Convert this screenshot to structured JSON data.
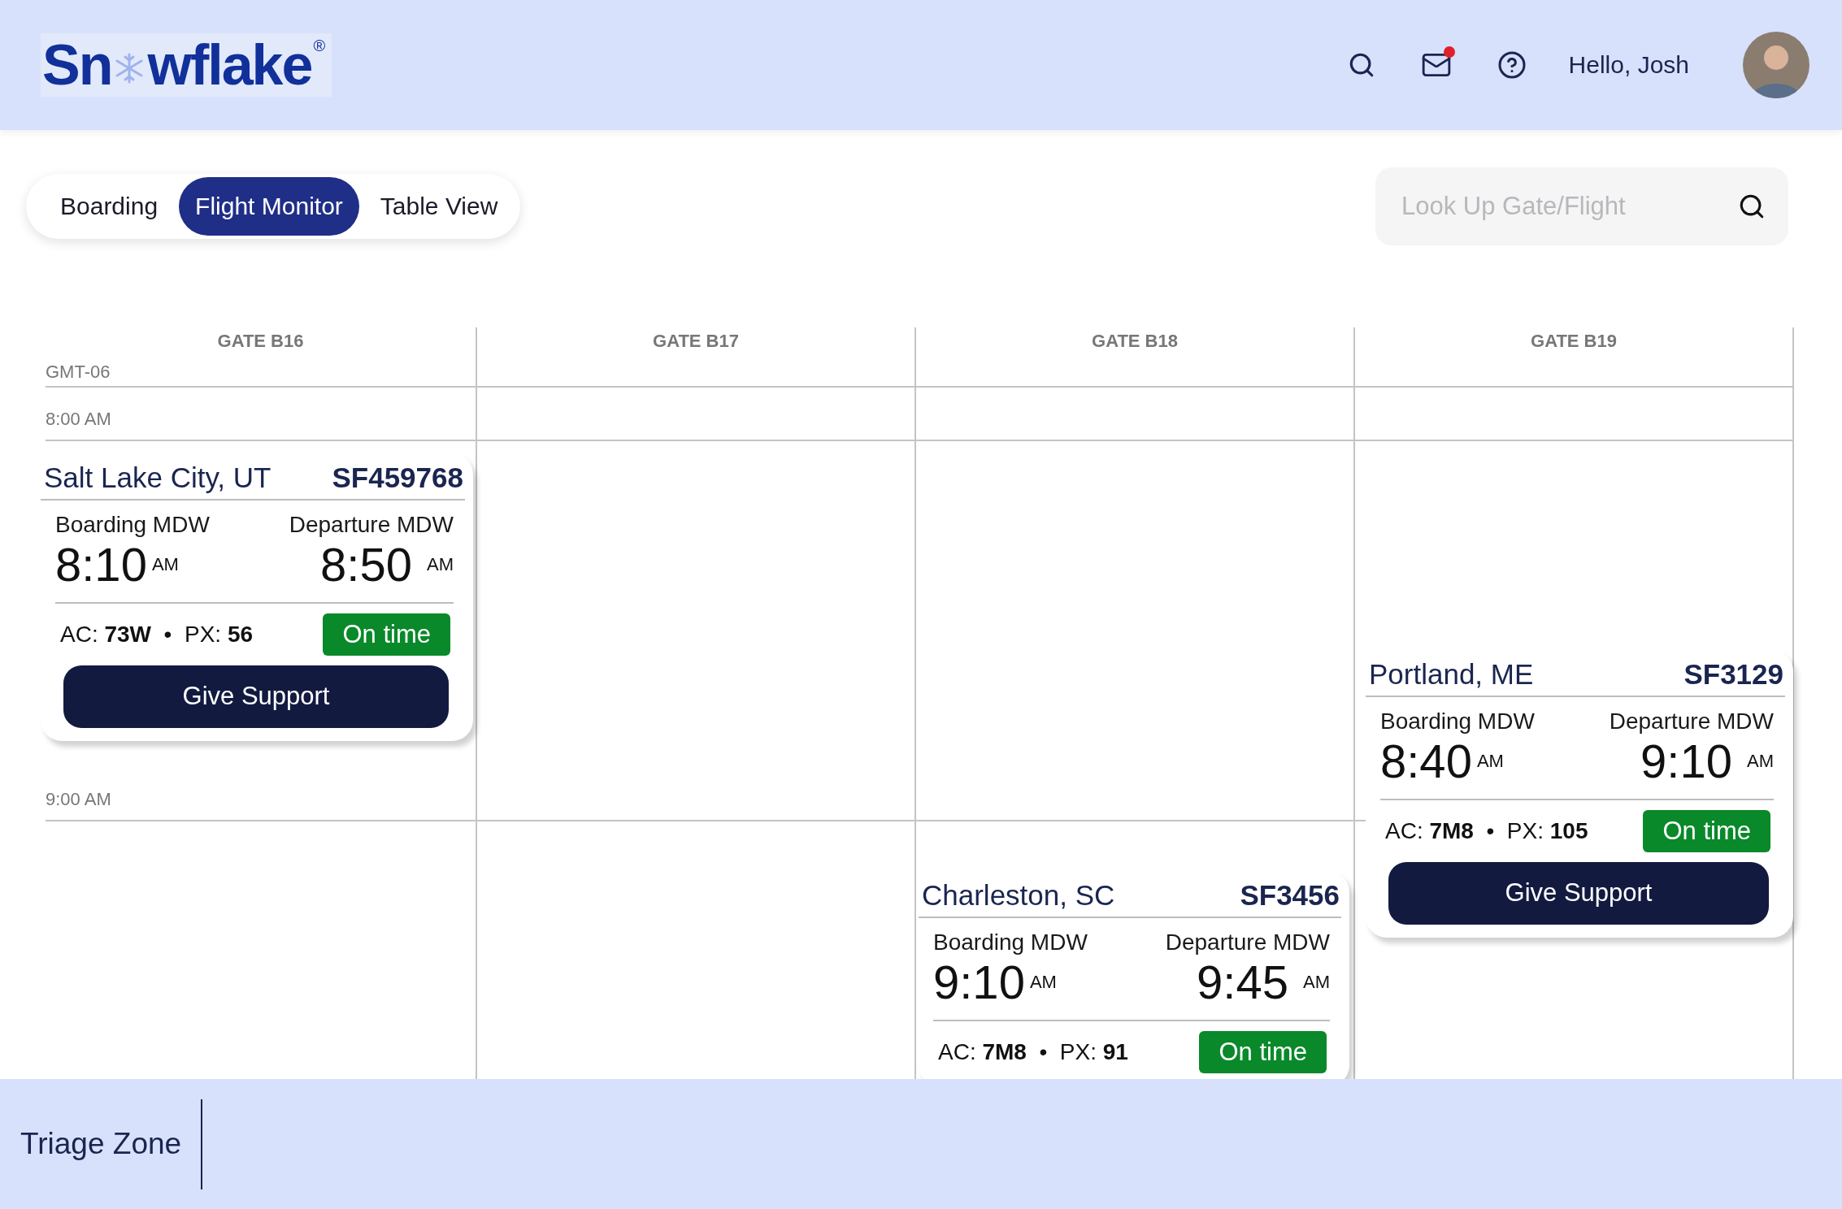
{
  "header": {
    "logo": {
      "before": "Sn",
      "after": "wflake",
      "mark": "®"
    },
    "mail_unread": true,
    "greeting": "Hello, Josh"
  },
  "tabs": [
    {
      "label": "Boarding",
      "selected": false
    },
    {
      "label": "Flight Monitor",
      "selected": true
    },
    {
      "label": "Table View",
      "selected": false
    }
  ],
  "search": {
    "placeholder": "Look Up Gate/Flight"
  },
  "timezone": "GMT-06",
  "times": [
    "8:00 AM",
    "9:00 AM"
  ],
  "gates": [
    {
      "label": "GATE B16",
      "flights": [
        {
          "city": "Salt Lake City, UT",
          "number": "SF459768",
          "boarding": {
            "label": "Boarding MDW",
            "time": "8:10",
            "period": "AM"
          },
          "departure": {
            "label": "Departure MDW",
            "time": "8:50",
            "period": "AM"
          },
          "info": "AC: **73W**  •  PX: **56**",
          "status": {
            "label": "On time",
            "kind": "on-time"
          },
          "button": "Give Support"
        }
      ]
    },
    {
      "label": "GATE B17"
    },
    {
      "label": "GATE B18",
      "flights": [
        {
          "city": "Charleston, SC",
          "number": "SF3456",
          "boarding": {
            "label": "Boarding MDW",
            "time": "9:10",
            "period": "AM"
          },
          "departure": {
            "label": "Departure MDW",
            "time": "9:45",
            "period": "AM"
          },
          "info": "AC: **7M8**  •  PX: **91**",
          "status": {
            "label": "On time",
            "kind": "on-time"
          }
        }
      ]
    },
    {
      "label": "GATE B19",
      "flights": [
        {
          "city": "Portland, ME",
          "number": "SF3129",
          "boarding": {
            "label": "Boarding MDW",
            "time": "8:40",
            "period": "AM"
          },
          "departure": {
            "label": "Departure MDW",
            "time": "9:10",
            "period": "AM"
          },
          "info": "AC: **7M8**  •  PX: **105**",
          "status": {
            "label": "On time",
            "kind": "on-time"
          },
          "button": "Give Support"
        }
      ]
    }
  ],
  "footer": {
    "title": "Triage Zone"
  }
}
